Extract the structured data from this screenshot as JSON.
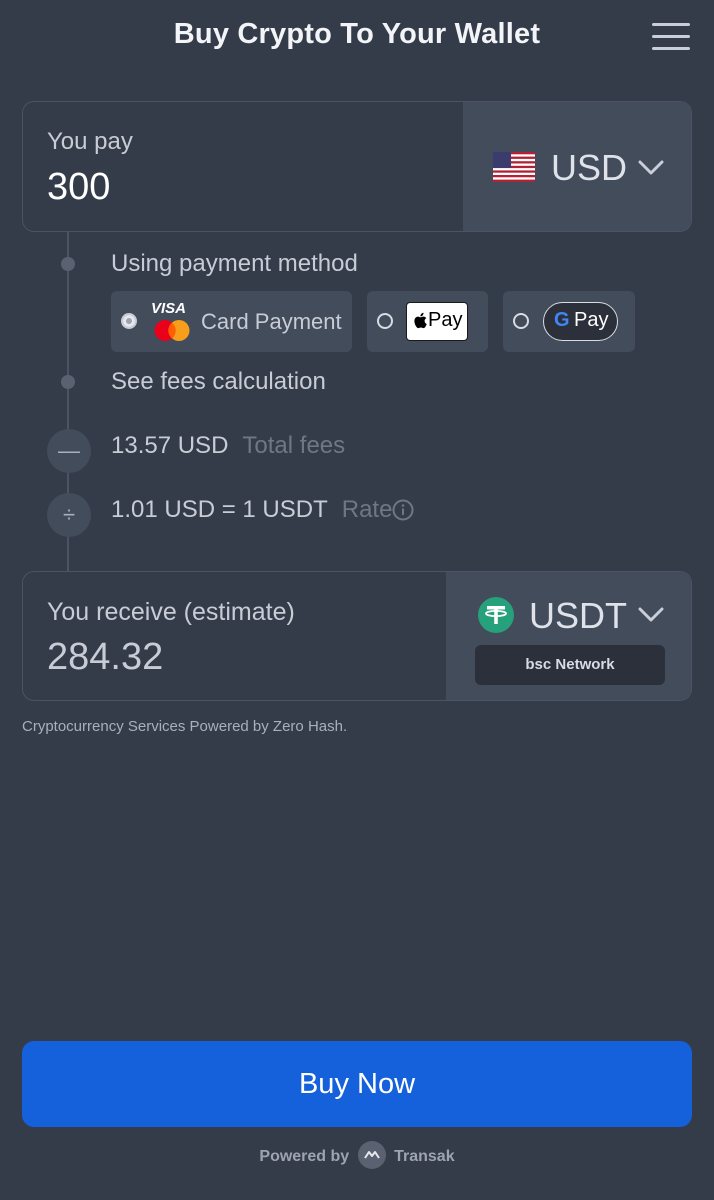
{
  "header": {
    "title": "Buy Crypto To Your Wallet",
    "menu_icon": "hamburger-menu-icon"
  },
  "pay": {
    "label": "You pay",
    "value": "300",
    "currency": "USD",
    "flag_icon": "us-flag-icon"
  },
  "payment_method": {
    "heading": "Using payment method",
    "options": [
      {
        "id": "card",
        "label": "Card Payment",
        "brand_visa": "VISA",
        "selected": true
      },
      {
        "id": "apple-pay",
        "label": "Pay",
        "selected": false
      },
      {
        "id": "google-pay",
        "label": "Pay",
        "brand_g": "G",
        "selected": false
      }
    ]
  },
  "fees": {
    "link": "See fees calculation",
    "total_value": "13.57 USD",
    "total_label": "Total fees",
    "total_icon_glyph": "—",
    "rate_value": "1.01 USD = 1 USDT",
    "rate_label": "Rate",
    "rate_icon_glyph": "÷"
  },
  "receive": {
    "label": "You receive (estimate)",
    "value": "284.32",
    "crypto": "USDT",
    "network": "bsc Network",
    "token_icon": "tether-icon"
  },
  "powered_zero_hash": "Cryptocurrency Services Powered by Zero Hash.",
  "buy_button": "Buy Now",
  "footer": {
    "powered_by": "Powered by",
    "brand": "Transak"
  },
  "colors": {
    "background": "#343b49",
    "panel": "#434c5b",
    "accent": "#1461db",
    "tether": "#26a17b"
  }
}
